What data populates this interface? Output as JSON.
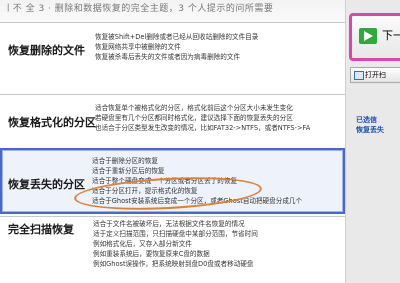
{
  "header_text": "ㅣ不 全 3 · 删除和数据恢复的完全主题，3 个人提示的问所需要",
  "options": [
    {
      "title": "恢复删除的文件",
      "lines": [
        "恢复被Shift+Del删除或者已经从回收站删除的文件目录",
        "恢复网络共享中被删除的文件",
        "恢复被杀毒后丢失的文件或者因为病毒删除的文件"
      ]
    },
    {
      "title": "恢复格式化的分区",
      "lines": [
        "适合恢复单个被格式化的分区，格式化前后这个分区大小未发生变化",
        "若硬盘里有几个分区都同时格式化，建议选择下面的恢复丢失的分区",
        "也适合于分区类型发生改变的情况，比如FAT32->NTFS，或者NTFS->FA"
      ]
    },
    {
      "title": "恢复丢失的分区",
      "lines": [
        "适合于删除分区的恢复",
        "适合于重新分区后的恢复",
        "适合于整个硬盘变成一个分区或者分区丢了的恢复",
        "适合于分区打开，提示格式化的恢复",
        "适合于Ghost安装系统后变成一个分区，或者Ghost自动把硬盘分成几个"
      ]
    },
    {
      "title": "完全扫描恢复",
      "lines": [
        "适合于文件名被破坏后，无法根据文件名恢复的情况",
        "适于定义扫描范围，只扫描硬盘中某部分范围，节省时间",
        "例如格式化后，又存入部分新文件",
        "例如重装系统后，要恢复原来C盘的数据",
        "例如Ghost误操作，把系统映射到盘D0盘或者移动硬盘"
      ]
    }
  ],
  "sidebar": {
    "next_label": "下一",
    "open_label": "打开扫",
    "text_lines": [
      "已选信",
      "恢复丢失"
    ]
  }
}
